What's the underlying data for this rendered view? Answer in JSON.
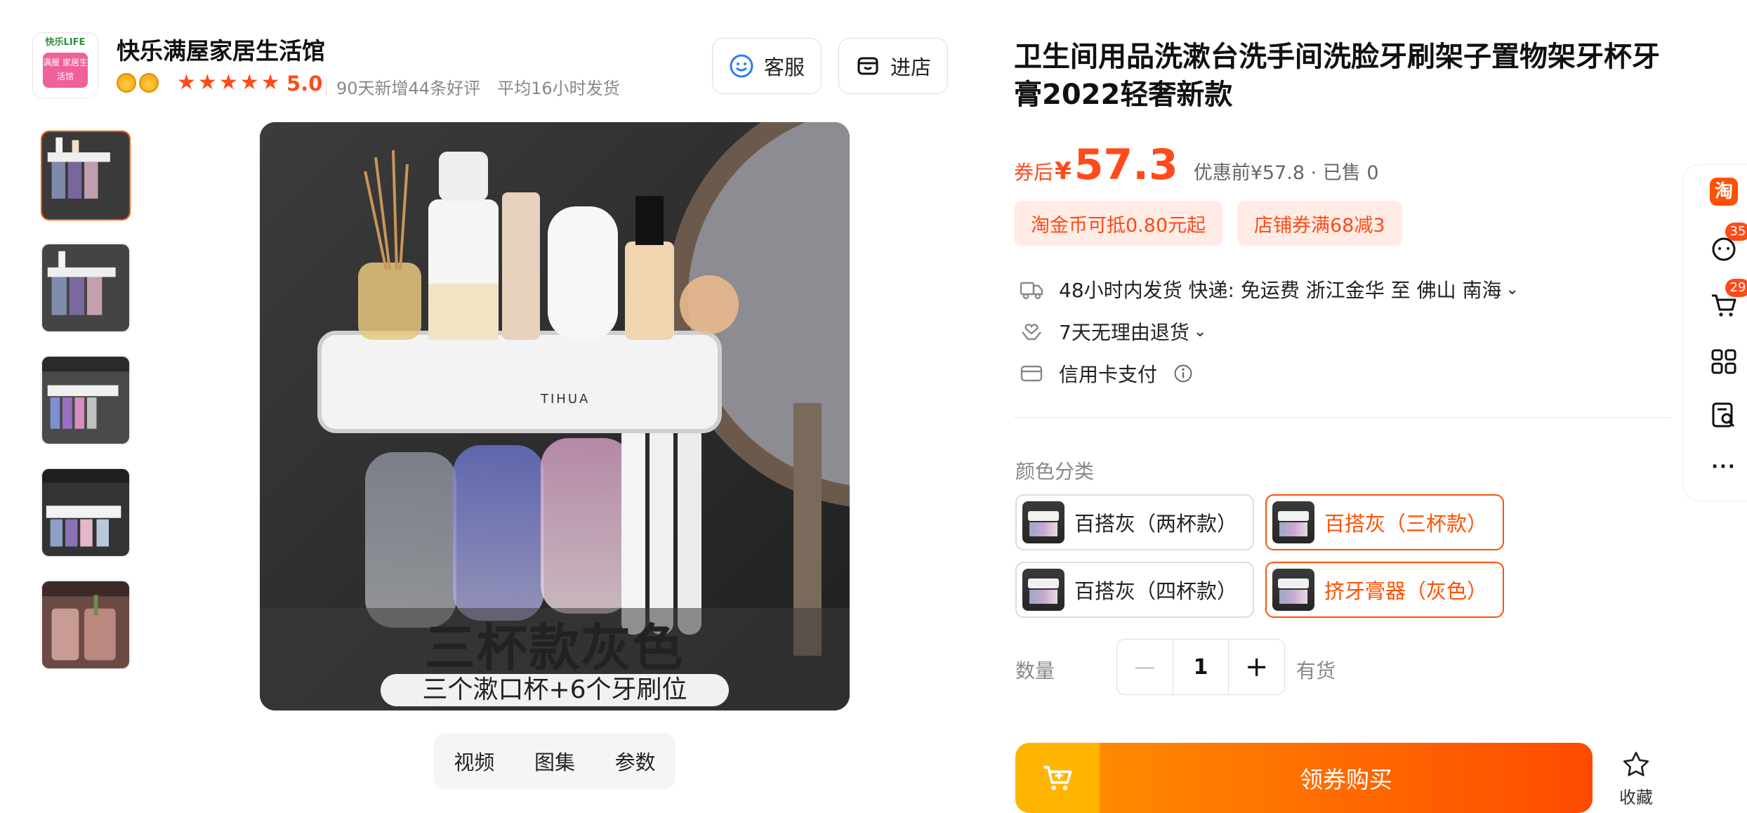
{
  "shop": {
    "logo_top": "快乐LIFE",
    "logo_badge": "满屋 家居生活馆",
    "name": "快乐满屋家居生活馆",
    "rating": "5.0",
    "stats_new": "90天新增44条好评",
    "stats_ship": "平均16小时发货",
    "btn_service": "客服",
    "btn_store": "进店"
  },
  "gallery": {
    "caption_main": "三杯款灰色",
    "caption_sub": "三个漱口杯+6个牙刷位",
    "tabs": [
      "视频",
      "图集",
      "参数"
    ]
  },
  "product": {
    "title": "卫生间用品洗漱台洗手间洗脸牙刷架子置物架牙杯牙膏2022轻奢新款",
    "price_prefix": "券后",
    "price_symbol": "¥",
    "price": "57.3",
    "price_original": "优惠前¥57.8 · 已售 0",
    "coupons": [
      "淘金币可抵0.80元起",
      "店铺券满68减3"
    ],
    "services": {
      "shipping": "48小时内发货  快递: 免运费  浙江金华 至 佛山 南海",
      "returns": "7天无理由退货",
      "payment": "信用卡支付"
    },
    "sku_label": "颜色分类",
    "skus": [
      "百搭灰（两杯款）",
      "百搭灰（三杯款）",
      "百搭灰（四杯款）",
      "挤牙膏器（灰色）"
    ],
    "qty_label": "数量",
    "qty": "1",
    "stock": "有货",
    "buy_label": "领券购买",
    "fav_label": "收藏"
  },
  "sidebar": {
    "taobao_glyph": "淘",
    "messages_count": "35",
    "cart_count": "29",
    "more_glyph": "···"
  },
  "colors": {
    "accent": "#ff5000",
    "price": "#ff4a1a",
    "coupon_bg": "#ffece5"
  }
}
